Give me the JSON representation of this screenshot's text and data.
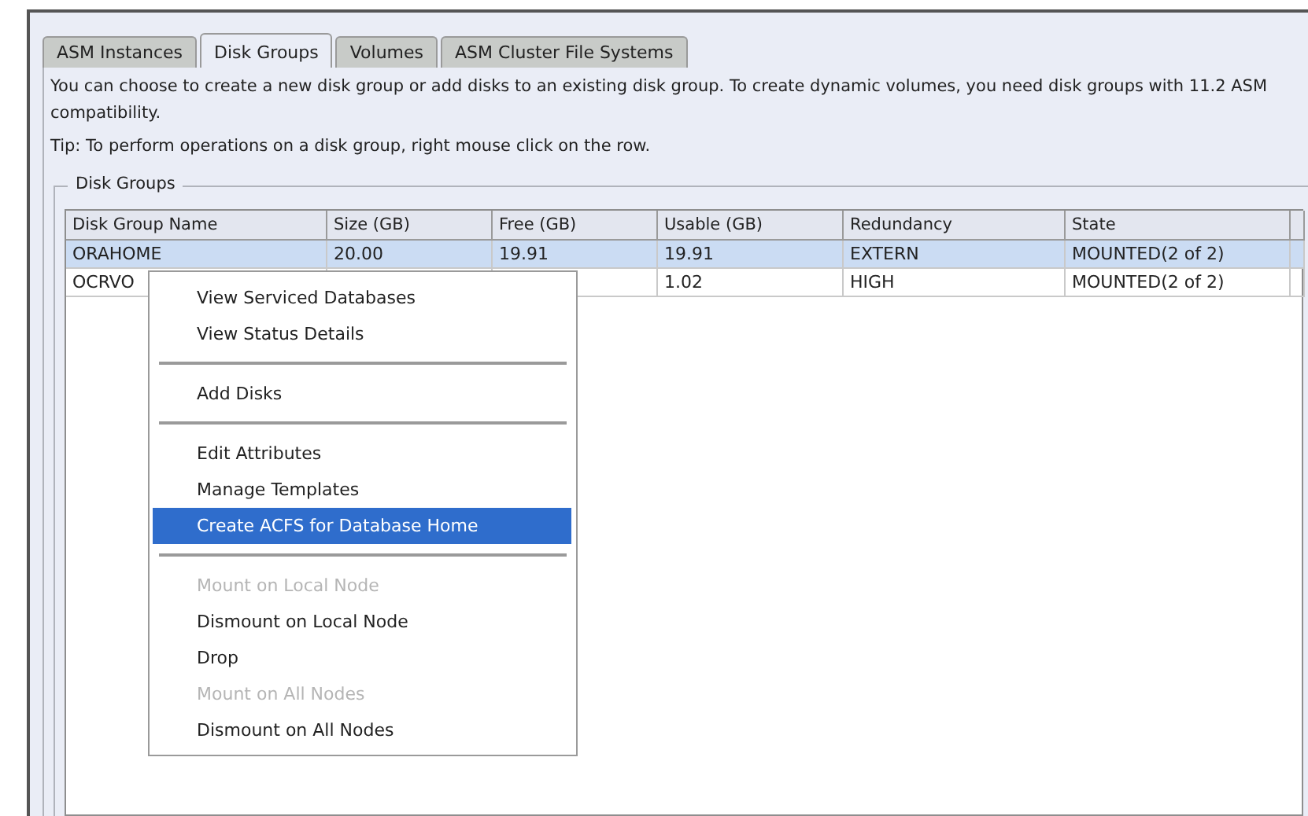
{
  "tabs": [
    {
      "label": "ASM Instances",
      "selected": false
    },
    {
      "label": "Disk Groups",
      "selected": true
    },
    {
      "label": "Volumes",
      "selected": false
    },
    {
      "label": "ASM Cluster File Systems",
      "selected": false
    }
  ],
  "description": "You can choose to create a new disk group or add disks to an existing disk group. To create dynamic volumes, you need disk groups with 11.2 ASM compatibility.",
  "tip": "Tip: To perform operations on a disk group, right mouse click on the row.",
  "group_title": "Disk Groups",
  "table": {
    "columns": [
      "Disk Group Name",
      "Size (GB)",
      "Free (GB)",
      "Usable (GB)",
      "Redundancy",
      "State"
    ],
    "rows": [
      {
        "selected": true,
        "cells": [
          "ORAHOME",
          "20.00",
          "19.91",
          "19.91",
          "EXTERN",
          "MOUNTED(2 of 2)"
        ]
      },
      {
        "selected": false,
        "cells": [
          "OCRVO",
          null,
          null,
          "1.02",
          "HIGH",
          "MOUNTED(2 of 2)"
        ]
      }
    ]
  },
  "context_menu": [
    {
      "kind": "item",
      "label": "View Serviced Databases",
      "disabled": false,
      "selected": false
    },
    {
      "kind": "item",
      "label": "View Status Details",
      "disabled": false,
      "selected": false
    },
    {
      "kind": "separator"
    },
    {
      "kind": "item",
      "label": "Add Disks",
      "disabled": false,
      "selected": false
    },
    {
      "kind": "separator"
    },
    {
      "kind": "item",
      "label": "Edit Attributes",
      "disabled": false,
      "selected": false
    },
    {
      "kind": "item",
      "label": "Manage Templates",
      "disabled": false,
      "selected": false
    },
    {
      "kind": "item",
      "label": "Create ACFS for Database Home",
      "disabled": false,
      "selected": true
    },
    {
      "kind": "separator"
    },
    {
      "kind": "item",
      "label": "Mount on Local Node",
      "disabled": true,
      "selected": false
    },
    {
      "kind": "item",
      "label": "Dismount on Local Node",
      "disabled": false,
      "selected": false
    },
    {
      "kind": "item",
      "label": "Drop",
      "disabled": false,
      "selected": false
    },
    {
      "kind": "item",
      "label": "Mount on All Nodes",
      "disabled": true,
      "selected": false
    },
    {
      "kind": "item",
      "label": "Dismount on All Nodes",
      "disabled": false,
      "selected": false
    }
  ]
}
